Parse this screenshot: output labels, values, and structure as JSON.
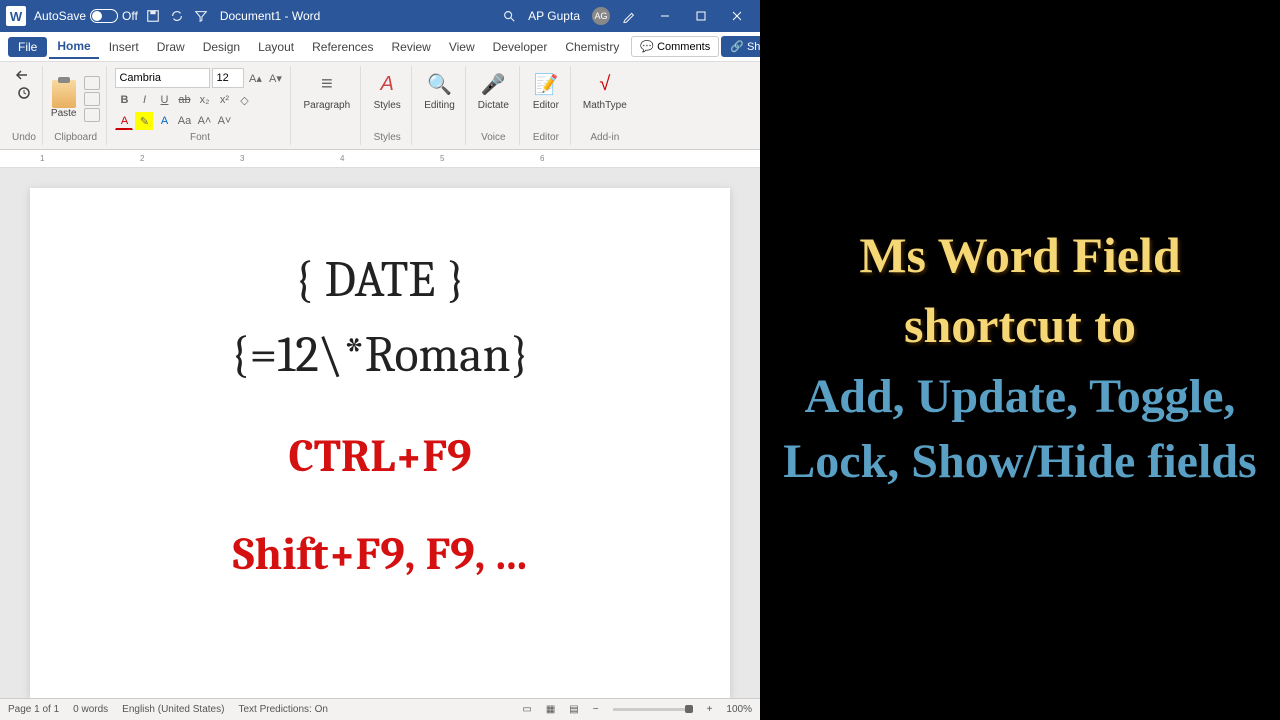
{
  "titlebar": {
    "logo": "W",
    "autosave_label": "AutoSave",
    "autosave_state": "Off",
    "doc_title": "Document1 - Word",
    "search_icon": "search",
    "user_name": "AP Gupta",
    "user_initials": "AG"
  },
  "tabs": {
    "file": "File",
    "home": "Home",
    "insert": "Insert",
    "draw": "Draw",
    "design": "Design",
    "layout": "Layout",
    "references": "References",
    "review": "Review",
    "view": "View",
    "developer": "Developer",
    "chemistry": "Chemistry",
    "comments": "Comments",
    "share": "Share"
  },
  "ribbon": {
    "undo_group": "Undo",
    "clipboard_group": "Clipboard",
    "paste": "Paste",
    "font_group": "Font",
    "font_name": "Cambria",
    "font_size": "12",
    "paragraph": "Paragraph",
    "styles_group": "Styles",
    "styles": "Styles",
    "editing": "Editing",
    "voice_group": "Voice",
    "dictate": "Dictate",
    "editor_group": "Editor",
    "editor": "Editor",
    "addin_group": "Add-in",
    "mathtype": "MathType"
  },
  "document": {
    "line1": "{ DATE }",
    "line2": "{=12\\*Roman}",
    "shortcut1": "CTRL+F9",
    "shortcut2": "Shift+F9, F9, ..."
  },
  "statusbar": {
    "page": "Page 1 of 1",
    "words": "0 words",
    "language": "English (United States)",
    "predictions": "Text Predictions: On",
    "zoom": "100%"
  },
  "side": {
    "yellow1": "Ms Word Field",
    "yellow2": "shortcut to",
    "blue": "Add, Update, Toggle, Lock, Show/Hide fields"
  }
}
